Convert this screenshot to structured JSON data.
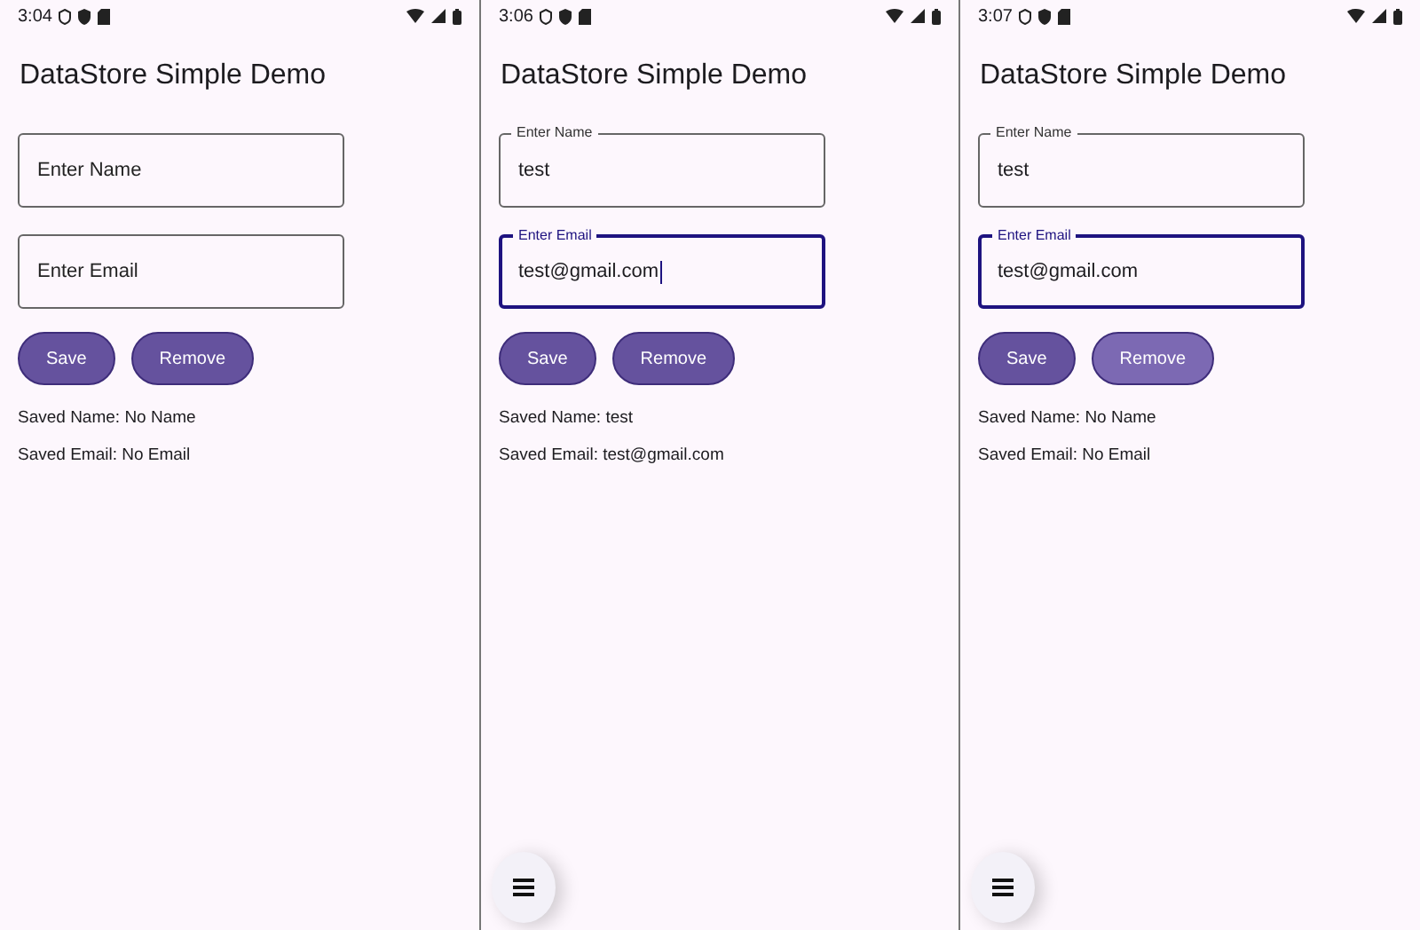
{
  "screens": [
    {
      "status_time": "3:04",
      "title": "DataStore Simple Demo",
      "fields": [
        {
          "placeholder": "Enter Name",
          "focused": false,
          "cursor": false
        },
        {
          "placeholder": "Enter Email",
          "focused": false,
          "cursor": false
        }
      ],
      "buttons": [
        {
          "label": "Save",
          "pressed": false
        },
        {
          "label": "Remove",
          "pressed": false
        }
      ],
      "saved": [
        "Saved Name: No Name",
        "Saved Email: No Email"
      ]
    },
    {
      "status_time": "3:06",
      "title": "DataStore Simple Demo",
      "fields": [
        {
          "label": "Enter Name",
          "value": "test",
          "focused": false,
          "cursor": false
        },
        {
          "label": "Enter Email",
          "value": "test@gmail.com",
          "focused": true,
          "cursor": true
        }
      ],
      "buttons": [
        {
          "label": "Save",
          "pressed": false
        },
        {
          "label": "Remove",
          "pressed": false
        }
      ],
      "saved": [
        "Saved Name: test",
        "Saved Email: test@gmail.com"
      ],
      "fab": true
    },
    {
      "status_time": "3:07",
      "title": "DataStore Simple Demo",
      "fields": [
        {
          "label": "Enter Name",
          "value": "test",
          "focused": false,
          "cursor": false
        },
        {
          "label": "Enter Email",
          "value": "test@gmail.com",
          "focused": true,
          "cursor": false
        }
      ],
      "buttons": [
        {
          "label": "Save",
          "pressed": false
        },
        {
          "label": "Remove",
          "pressed": true
        }
      ],
      "saved": [
        "Saved Name: No Name",
        "Saved Email: No Email"
      ],
      "fab": true
    }
  ]
}
